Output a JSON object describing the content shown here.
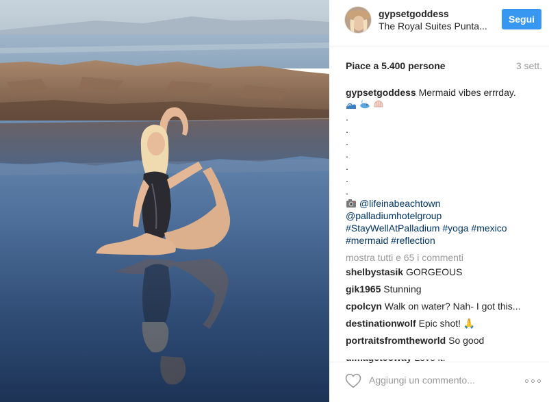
{
  "post": {
    "author": "gypsetgoddess",
    "location": "The Royal Suites Punta...",
    "follow_label": "Segui",
    "likes": "Piace a 5.400 persone",
    "time": "3 sett.",
    "caption": {
      "author": "gypsetgoddess",
      "text": "Mermaid vibes errrday.",
      "emojis": [
        "wave-emoji",
        "whale-emoji",
        "shell-emoji"
      ],
      "dots": [
        ".",
        ".",
        ".",
        ".",
        ".",
        ".",
        "."
      ],
      "camera_emoji": "camera-emoji",
      "mention1": "@lifeinabeachtown",
      "mention2": "@palladiumhotelgroup",
      "hashtags": [
        "#StayWellAtPalladium",
        "#yoga",
        "#mexico",
        "#mermaid",
        "#reflection"
      ]
    },
    "show_all_comments": "mostra tutti e 65 i commenti",
    "comments": [
      {
        "user": "shelbystasik",
        "text": "GORGEOUS"
      },
      {
        "user": "gik1965",
        "text": "Stunning"
      },
      {
        "user": "cpolcyn",
        "text": "Walk on water? Nah- I got this..."
      },
      {
        "user": "destinationwolf",
        "text": "Epic shot! 🙏"
      },
      {
        "user": "portraitsfromtheworld",
        "text": "So good"
      },
      {
        "user": "dimagetcoway",
        "text": "Love it!"
      }
    ],
    "add_comment_placeholder": "Aggiungi un commento...",
    "icons": {
      "like": "heart-icon",
      "more": "more-options-icon"
    }
  }
}
